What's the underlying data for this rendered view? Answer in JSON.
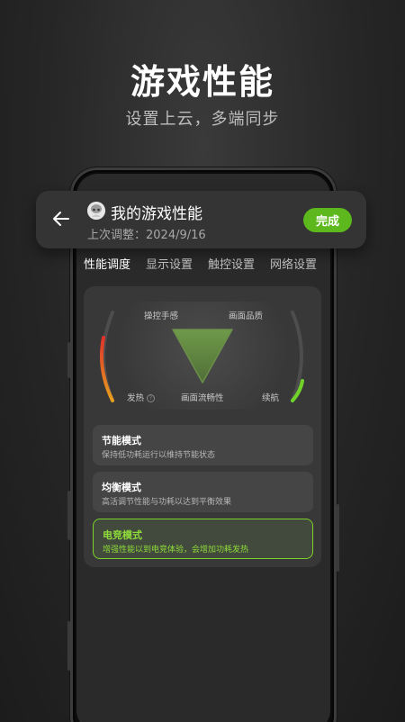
{
  "promo": {
    "title": "游戏性能",
    "subtitle": "设置上云，多端同步"
  },
  "header": {
    "title": "我的游戏性能",
    "last_adjusted": "上次调整：2024/9/16",
    "done_label": "完成",
    "back_icon": "arrow-left-icon",
    "avatar_icon": "avatar-icon"
  },
  "tabs": [
    {
      "label": "性能调度",
      "active": true
    },
    {
      "label": "显示设置",
      "active": false
    },
    {
      "label": "触控设置",
      "active": false
    },
    {
      "label": "网络设置",
      "active": false
    }
  ],
  "gauge": {
    "top_left": "操控手感",
    "top_right": "画面品质",
    "bottom_center": "画面流畅性",
    "heat_label": "发热",
    "battery_label": "续航",
    "info_icon": "info-icon",
    "heat_level": 0.55,
    "battery_level": 0.3
  },
  "modes": [
    {
      "name": "节能模式",
      "desc": "保持低功耗运行以维持节能状态",
      "selected": false
    },
    {
      "name": "均衡模式",
      "desc": "高活调节性能与功耗以达到平衡效果",
      "selected": false
    },
    {
      "name": "电竞模式",
      "desc": "增强性能以到电竞体验，会增加功耗发热",
      "selected": true
    }
  ],
  "colors": {
    "accent": "#5cb81c",
    "selected_border": "#7dd12c",
    "heat_gradient": [
      "#e0322a",
      "#e6a01f"
    ],
    "battery_color": "#6fd12a",
    "triangle": "#6b8f4a"
  }
}
